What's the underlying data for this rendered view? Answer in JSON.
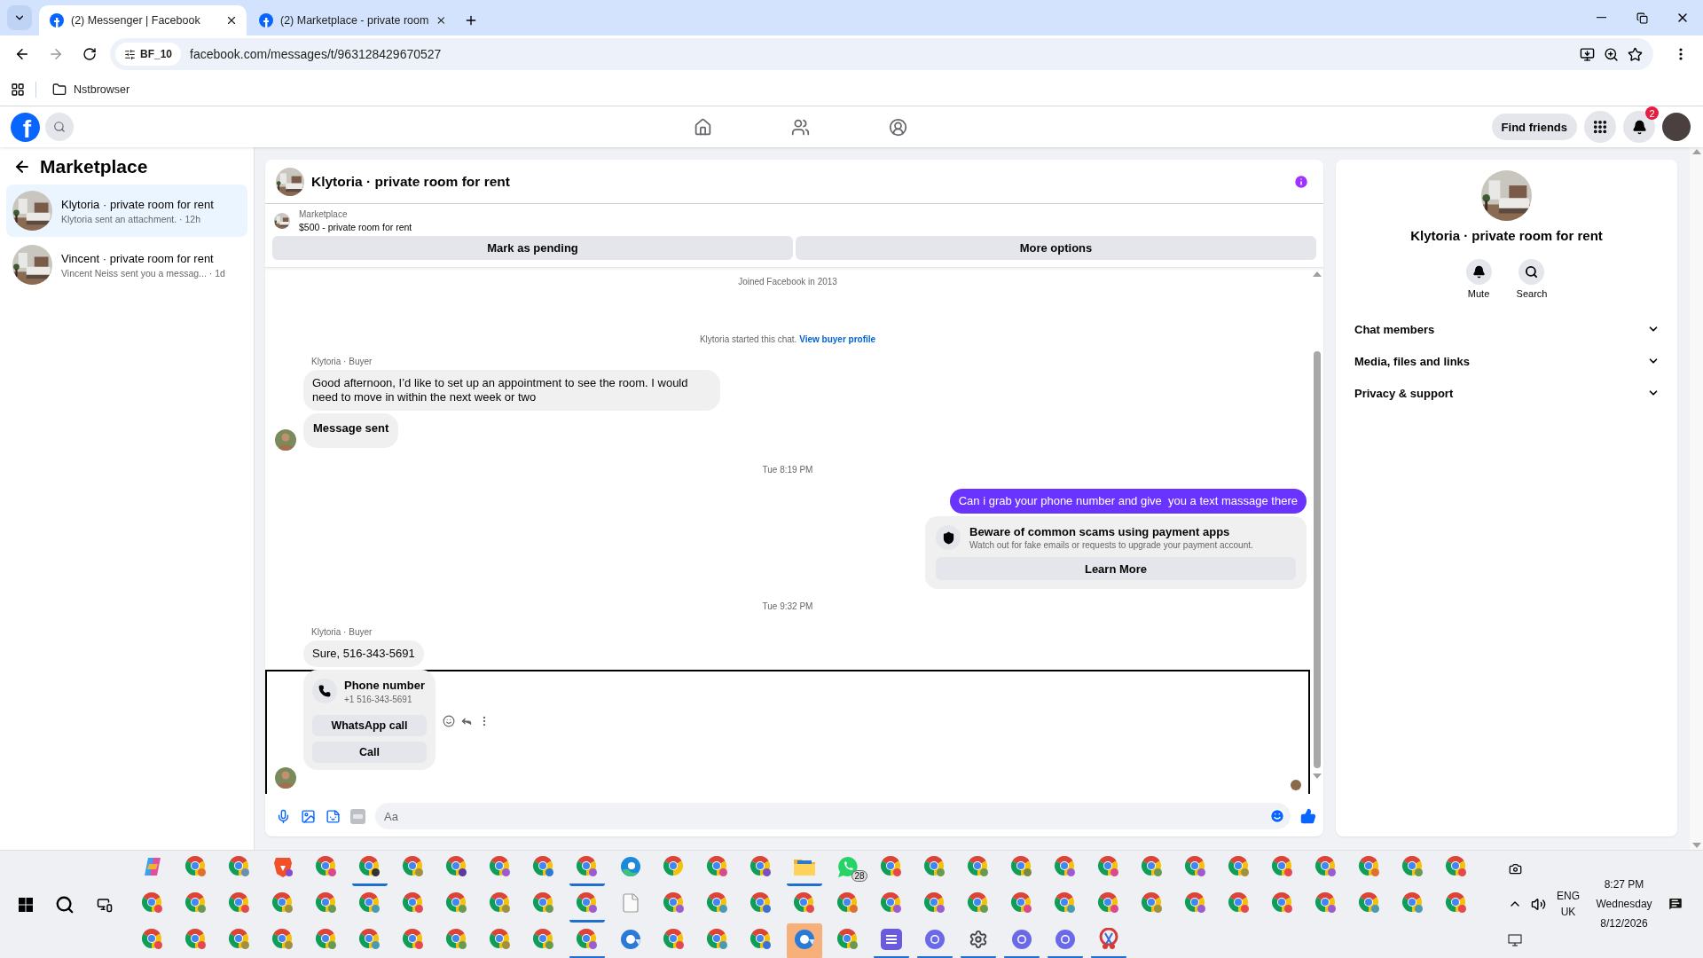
{
  "browser": {
    "tabs": [
      {
        "title": "(2) Messenger | Facebook",
        "selected": true
      },
      {
        "title": "(2) Marketplace - private room",
        "selected": false
      }
    ],
    "site_chip": "BF_10",
    "url": "facebook.com/messages/t/963128429670527",
    "bookmarks": [
      {
        "label": "Nstbrowser"
      }
    ]
  },
  "topnav": {
    "logo": "f",
    "nav_icons": [
      {
        "kind": "home"
      },
      {
        "kind": "friends"
      },
      {
        "kind": "groups"
      }
    ],
    "find_friends": "Find friends",
    "notification_count": "2"
  },
  "sidebar": {
    "title": "Marketplace",
    "conversations": [
      {
        "title": "Klytoria · private room for rent",
        "preview": "Klytoria sent an attachment. · 12h",
        "selected": true
      },
      {
        "title": "Vincent · private room for rent",
        "preview": "Vincent Neiss sent you a messag... · 1d",
        "selected": false
      }
    ]
  },
  "chat": {
    "title": "Klytoria · private room for rent",
    "listing": {
      "label": "Marketplace",
      "price_title": "$500 - private room for rent"
    },
    "actions": [
      "Mark as pending",
      "More options"
    ],
    "messages": [
      {
        "kind": "note",
        "text": "Joined Facebook in 2013"
      },
      {
        "kind": "system",
        "text": "Klytoria started this chat.",
        "link": "View buyer profile"
      },
      {
        "kind": "incoming",
        "sender": "Klytoria · Buyer",
        "focused": false,
        "bubbles": [
          {
            "kind": "text",
            "text": "Good afternoon, I’d like to set up an appointment to see the room. I would need to move in within the next week or two"
          },
          {
            "kind": "status",
            "text": "Message sent"
          }
        ]
      },
      {
        "kind": "time",
        "text": "Tue 8:19 PM"
      },
      {
        "kind": "outgoing",
        "text": "Can i grab your phone number and give  you a text massage there"
      },
      {
        "kind": "warning",
        "title": "Beware of common scams using payment apps",
        "body": "Watch out for fake emails or requests to upgrade your payment account.",
        "button": "Learn More"
      },
      {
        "kind": "time",
        "text": "Tue 9:32 PM"
      },
      {
        "kind": "incoming",
        "sender": "Klytoria · Buyer",
        "focused": true,
        "bubbles": [
          {
            "kind": "text",
            "text": "Sure, 516-343-5691"
          },
          {
            "kind": "phone",
            "title": "Phone number",
            "number": "+1 516-343-5691",
            "buttons": [
              "WhatsApp call",
              "Call"
            ]
          }
        ]
      }
    ],
    "composer": {
      "placeholder": "Aa"
    }
  },
  "details": {
    "title": "Klytoria · private room for rent",
    "actions": [
      {
        "kind": "bell",
        "label": "Mute"
      },
      {
        "kind": "search",
        "label": "Search"
      }
    ],
    "sections": [
      {
        "label": "Chat members",
        "expanded": false
      },
      {
        "label": "Media, files and links",
        "expanded": false
      },
      {
        "label": "Privacy & support",
        "expanded": false
      }
    ]
  },
  "taskbar": {
    "rows": [
      [
        {
          "kind": "copilot",
          "running": false,
          "flashing": false
        },
        {
          "kind": "chrome",
          "color": "#e07030",
          "running": false,
          "flashing": false
        },
        {
          "kind": "chrome",
          "color": "#6a8fb0",
          "running": false,
          "flashing": false
        },
        {
          "kind": "brave",
          "running": false,
          "flashing": false
        },
        {
          "kind": "chrome",
          "color": "#d94a8c",
          "running": false,
          "flashing": false
        },
        {
          "kind": "chrome",
          "color": "#333333",
          "running": true,
          "flashing": false
        },
        {
          "kind": "chrome",
          "color": "#a09040",
          "running": false,
          "flashing": false
        },
        {
          "kind": "chrome",
          "color": "#5a3aa0",
          "running": false,
          "flashing": false
        },
        {
          "kind": "chrome",
          "color": "#9a5cd0",
          "running": false,
          "flashing": false
        },
        {
          "kind": "chrome",
          "color": "#2a7ad0",
          "running": false,
          "flashing": false
        },
        {
          "kind": "chrome",
          "color": "#9a5cd0",
          "running": true,
          "flashing": false
        },
        {
          "kind": "edge",
          "running": false,
          "flashing": false
        },
        {
          "kind": "chrome",
          "running": false,
          "flashing": false
        },
        {
          "kind": "chrome",
          "color": "#d94a8c",
          "running": false,
          "flashing": false
        },
        {
          "kind": "chrome",
          "color": "#7a50c0",
          "running": false,
          "flashing": false
        },
        {
          "kind": "folder",
          "running": true,
          "flashing": false
        },
        {
          "kind": "whatsapp",
          "badge": "28",
          "running": false,
          "flashing": false
        },
        {
          "kind": "chrome",
          "color": "#e5484d",
          "running": false,
          "flashing": false
        },
        {
          "kind": "chrome",
          "color": "#6a9a50",
          "running": false,
          "flashing": false
        },
        {
          "kind": "chrome",
          "color": "#6a9a50",
          "running": false,
          "flashing": false
        },
        {
          "kind": "chrome",
          "color": "#7a8a40",
          "running": false,
          "flashing": false
        },
        {
          "kind": "chrome",
          "color": "#9a5cd0",
          "running": false,
          "flashing": false
        },
        {
          "kind": "chrome",
          "color": "#d94a8c",
          "running": false,
          "flashing": false
        },
        {
          "kind": "chrome",
          "color": "#6a9a50",
          "running": false,
          "flashing": false
        },
        {
          "kind": "chrome",
          "color": "#9a5cd0",
          "running": false,
          "flashing": false
        },
        {
          "kind": "chrome",
          "color": "#a09040",
          "running": false,
          "flashing": false
        },
        {
          "kind": "chrome",
          "color": "#e5484d",
          "running": false,
          "flashing": false
        },
        {
          "kind": "chrome",
          "color": "#9a5cd0",
          "running": false,
          "flashing": false
        },
        {
          "kind": "chrome",
          "color": "#e07030",
          "running": false,
          "flashing": false
        },
        {
          "kind": "chrome",
          "color": "#6a9a50",
          "running": false,
          "flashing": false
        },
        {
          "kind": "chrome",
          "color": "#e5484d",
          "running": false,
          "flashing": false
        }
      ],
      [
        {
          "kind": "chrome",
          "color": "#e5484d",
          "running": false,
          "flashing": false
        },
        {
          "kind": "chrome",
          "color": "#6a9a50",
          "running": false,
          "flashing": false
        },
        {
          "kind": "chrome",
          "color": "#e5484d",
          "running": false,
          "flashing": false
        },
        {
          "kind": "chrome",
          "color": "#a09040",
          "running": false,
          "flashing": false
        },
        {
          "kind": "chrome",
          "color": "#6a9a50",
          "running": false,
          "flashing": false
        },
        {
          "kind": "chrome",
          "color": "#4a9ab0",
          "running": false,
          "flashing": false
        },
        {
          "kind": "chrome",
          "color": "#e5484d",
          "running": false,
          "flashing": false
        },
        {
          "kind": "chrome",
          "color": "#6a9a50",
          "running": false,
          "flashing": false
        },
        {
          "kind": "chrome",
          "color": "#a09040",
          "running": false,
          "flashing": false
        },
        {
          "kind": "chrome",
          "color": "#6a9a50",
          "running": false,
          "flashing": false
        },
        {
          "kind": "chrome",
          "color": "#9a5cd0",
          "running": true,
          "flashing": false
        },
        {
          "kind": "file",
          "running": false,
          "flashing": false
        },
        {
          "kind": "chrome",
          "color": "#9a5cd0",
          "running": false,
          "flashing": false
        },
        {
          "kind": "chrome",
          "color": "#4a9ab0",
          "running": false,
          "flashing": false
        },
        {
          "kind": "chrome",
          "color": "#3b6fd8",
          "running": false,
          "flashing": false
        },
        {
          "kind": "chrome",
          "color": "#e5484d",
          "running": false,
          "flashing": false
        },
        {
          "kind": "chrome",
          "color": "#e07030",
          "running": false,
          "flashing": false
        },
        {
          "kind": "chrome",
          "color": "#9a5cd0",
          "running": false,
          "flashing": false
        },
        {
          "kind": "chrome",
          "color": "#9a5cd0",
          "running": false,
          "flashing": false
        },
        {
          "kind": "chrome",
          "color": "#6a9a50",
          "running": false,
          "flashing": false
        },
        {
          "kind": "chrome",
          "color": "#d94a8c",
          "running": false,
          "flashing": false
        },
        {
          "kind": "chrome",
          "color": "#4a9ab0",
          "running": false,
          "flashing": false
        },
        {
          "kind": "chrome",
          "color": "#d94a8c",
          "running": false,
          "flashing": false
        },
        {
          "kind": "chrome",
          "color": "#a09040",
          "running": false,
          "flashing": false
        },
        {
          "kind": "chrome",
          "color": "#9a5cd0",
          "running": false,
          "flashing": false
        },
        {
          "kind": "chrome",
          "color": "#e5484d",
          "running": false,
          "flashing": false
        },
        {
          "kind": "chrome",
          "color": "#e5484d",
          "running": false,
          "flashing": false
        },
        {
          "kind": "chrome",
          "color": "#9a5cd0",
          "running": false,
          "flashing": false
        },
        {
          "kind": "chrome",
          "color": "#4a9ab0",
          "running": false,
          "flashing": false
        },
        {
          "kind": "chrome",
          "color": "#4a9ab0",
          "running": false,
          "flashing": false
        },
        {
          "kind": "chrome",
          "color": "#e5484d",
          "running": false,
          "flashing": false
        }
      ],
      [
        {
          "kind": "chrome",
          "color": "#e5484d",
          "running": false,
          "flashing": false
        },
        {
          "kind": "chrome",
          "color": "#e5484d",
          "running": false,
          "flashing": false
        },
        {
          "kind": "chrome",
          "color": "#a09040",
          "running": false,
          "flashing": false
        },
        {
          "kind": "chrome",
          "color": "#a09040",
          "running": false,
          "flashing": false
        },
        {
          "kind": "chrome",
          "color": "#6a9a50",
          "running": false,
          "flashing": false
        },
        {
          "kind": "chrome",
          "color": "#4a9ab0",
          "running": false,
          "flashing": false
        },
        {
          "kind": "chrome",
          "color": "#e5484d",
          "running": false,
          "flashing": false
        },
        {
          "kind": "chrome",
          "color": "#6a9a50",
          "running": false,
          "flashing": false
        },
        {
          "kind": "chrome",
          "color": "#a09040",
          "running": false,
          "flashing": false
        },
        {
          "kind": "chrome",
          "color": "#6a9a50",
          "running": false,
          "flashing": false
        },
        {
          "kind": "chrome",
          "color": "#9a5cd0",
          "running": true,
          "flashing": false
        },
        {
          "kind": "chromium",
          "running": false,
          "flashing": false
        },
        {
          "kind": "chrome",
          "color": "#e5484d",
          "running": false,
          "flashing": false
        },
        {
          "kind": "chrome",
          "color": "#4a9ab0",
          "running": false,
          "flashing": false
        },
        {
          "kind": "chrome",
          "color": "#3b6fd8",
          "running": false,
          "flashing": false
        },
        {
          "kind": "chromium",
          "running": false,
          "flashing": true
        },
        {
          "kind": "chrome",
          "color": "#6a9a50",
          "running": false,
          "flashing": false
        },
        {
          "kind": "app",
          "running": true,
          "flashing": false
        },
        {
          "kind": "ring",
          "running": true,
          "flashing": false
        },
        {
          "kind": "gear",
          "running": true,
          "flashing": false
        },
        {
          "kind": "ring",
          "running": true,
          "flashing": false
        },
        {
          "kind": "ring",
          "running": true,
          "flashing": false
        },
        {
          "kind": "snip",
          "running": true,
          "flashing": false
        }
      ]
    ],
    "tray": {
      "language": "ENG",
      "region": "UK",
      "time": "8:27 PM",
      "day": "Wednesday",
      "date": "8/12/2026"
    }
  }
}
